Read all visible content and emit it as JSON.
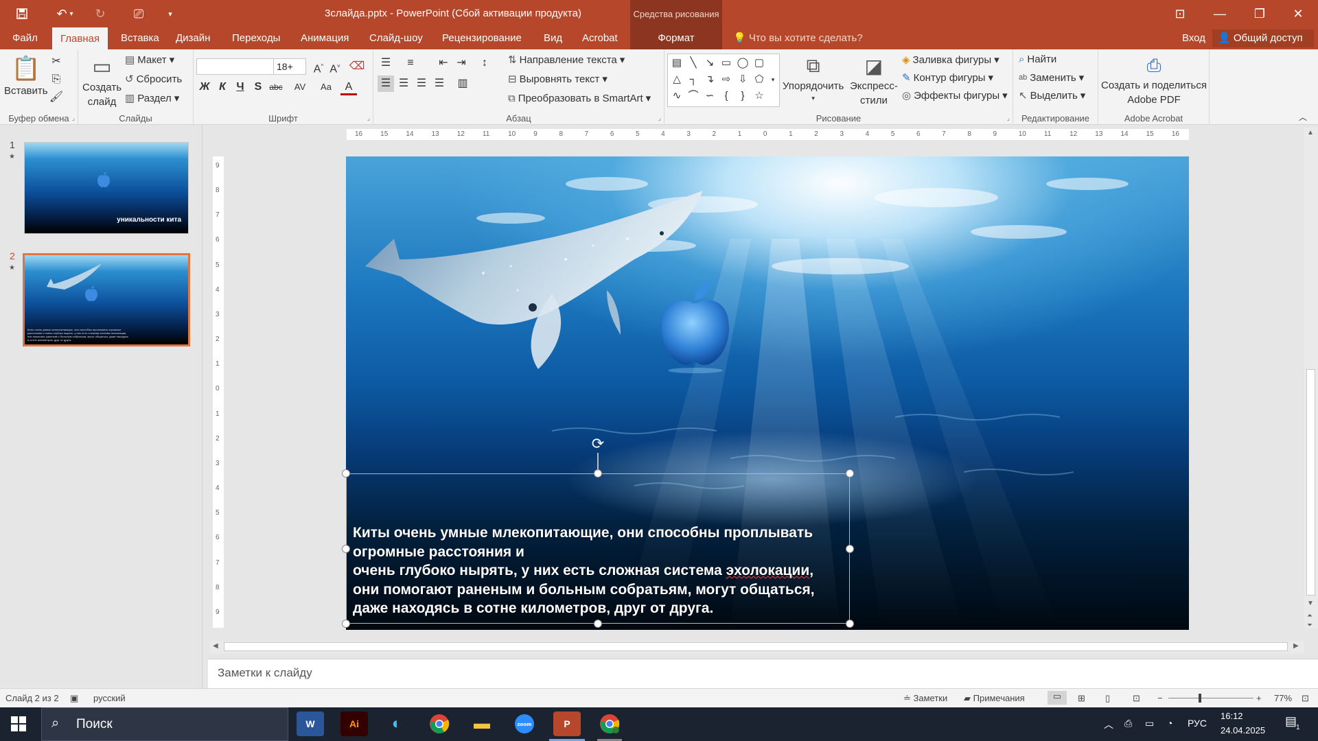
{
  "titlebar": {
    "title": "3слайда.pptx - PowerPoint (Сбой активации продукта)",
    "contextual_group": "Средства рисования"
  },
  "tabs": [
    "Файл",
    "Главная",
    "Вставка",
    "Дизайн",
    "Переходы",
    "Анимация",
    "Слайд-шоу",
    "Рецензирование",
    "Вид",
    "Acrobat",
    "Формат"
  ],
  "tell_me_placeholder": "Что вы хотите сделать?",
  "signin": "Вход",
  "share": "Общий доступ",
  "ribbon": {
    "clipboard": {
      "paste": "Вставить",
      "label": "Буфер обмена"
    },
    "slides": {
      "new_slide_line1": "Создать",
      "new_slide_line2": "слайд",
      "layout": "Макет",
      "reset": "Сбросить",
      "section": "Раздел",
      "label": "Слайды"
    },
    "font": {
      "font_name": "",
      "font_size": "18+",
      "bold": "Ж",
      "italic": "К",
      "underline": "Ч",
      "shadow": "S",
      "strike": "abc",
      "spacing": "AV",
      "case": "Aa",
      "color": "A",
      "label": "Шрифт"
    },
    "paragraph": {
      "text_direction": "Направление текста",
      "align_text": "Выровнять текст",
      "smartart": "Преобразовать в SmartArt",
      "label": "Абзац"
    },
    "drawing": {
      "arrange": "Упорядочить",
      "quick_styles_line1": "Экспресс-",
      "quick_styles_line2": "стили",
      "fill": "Заливка фигуры",
      "outline": "Контур фигуры",
      "effects": "Эффекты фигуры",
      "label": "Рисование"
    },
    "editing": {
      "find": "Найти",
      "replace": "Заменить",
      "select": "Выделить",
      "label": "Редактирование"
    },
    "acrobat": {
      "create_line1": "Создать и поделиться",
      "create_line2": "Adobe PDF",
      "label": "Adobe Acrobat"
    }
  },
  "slides_panel": [
    {
      "number": "1",
      "caption": "уникальности кита"
    },
    {
      "number": "2",
      "caption": "Киты очень умные млекопитающие, они способны проплывать огромные расстояния и очень глубоко нырять, у них есть сложная система эхолокации, они помогают раненым и больным собратьям, могут общаться, даже находясь в сотне километров, друг от друга."
    }
  ],
  "hruler_ticks": [
    "16",
    "15",
    "14",
    "13",
    "12",
    "11",
    "10",
    "9",
    "8",
    "7",
    "6",
    "5",
    "4",
    "3",
    "2",
    "1",
    "0",
    "1",
    "2",
    "3",
    "4",
    "5",
    "6",
    "7",
    "8",
    "9",
    "10",
    "11",
    "12",
    "13",
    "14",
    "15",
    "16"
  ],
  "vruler_ticks": [
    "9",
    "8",
    "7",
    "6",
    "5",
    "4",
    "3",
    "2",
    "1",
    "0",
    "1",
    "2",
    "3",
    "4",
    "5",
    "6",
    "7",
    "8",
    "9"
  ],
  "slide": {
    "line1": "Киты очень умные млекопитающие, они способны проплывать",
    "line2": " огромные расстояния и",
    "line3_pre": "очень глубоко нырять, у них есть сложная система ",
    "line3_misspelled": "эхолокации",
    "line3_post": ",",
    "line4": "они помогают раненым и больным собратьям, могут общаться,",
    "line5": "даже находясь в сотне километров, друг от друга."
  },
  "notes_placeholder": "Заметки к слайду",
  "statusbar": {
    "slide_info": "Слайд 2 из 2",
    "language": "русский",
    "notes": "Заметки",
    "comments": "Примечания",
    "zoom": "77%"
  },
  "taskbar": {
    "search": "Поиск",
    "lang": "РУС",
    "time": "16:12",
    "date": "24.04.2025",
    "notification_count": "1"
  },
  "colors": {
    "accent": "#b7472a",
    "contextual": "#8c3520",
    "taskbar": "#1b2331"
  }
}
